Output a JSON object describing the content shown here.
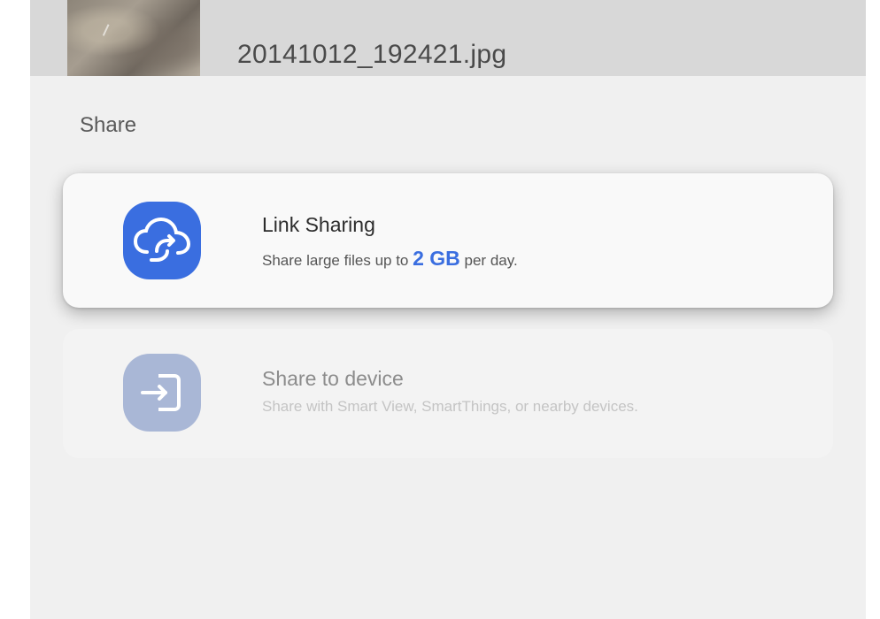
{
  "file": {
    "name": "20141012_192421.jpg"
  },
  "share": {
    "title": "Share"
  },
  "options": [
    {
      "title": "Link Sharing",
      "subtitle_prefix": "Share large files up to ",
      "subtitle_highlight": "2 GB",
      "subtitle_suffix": " per day.",
      "icon": "cloud-link-icon",
      "icon_color": "#3a6ee0"
    },
    {
      "title": "Share to device",
      "subtitle": "Share with Smart View, SmartThings, or nearby devices.",
      "icon": "device-share-icon",
      "icon_color": "#a9b7d6"
    }
  ]
}
